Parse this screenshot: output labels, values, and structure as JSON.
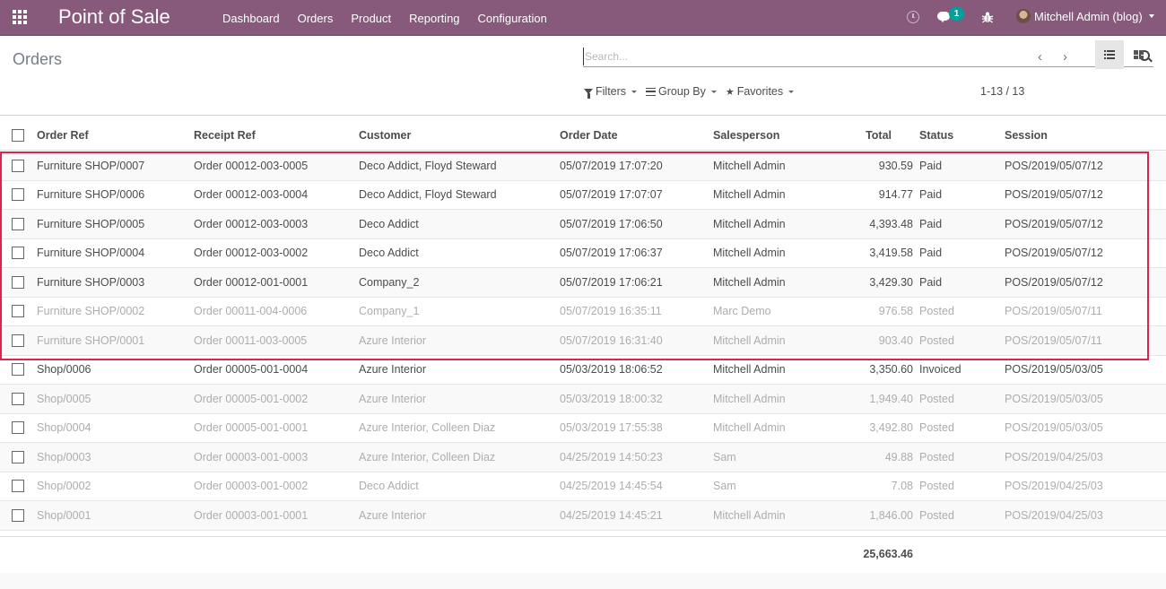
{
  "navbar": {
    "brand": "Point of Sale",
    "menu": [
      "Dashboard",
      "Orders",
      "Product",
      "Reporting",
      "Configuration"
    ],
    "chat_badge": "1",
    "user_name": "Mitchell Admin (blog)"
  },
  "control_panel": {
    "title": "Orders",
    "search_placeholder": "Search...",
    "filters_label": "Filters",
    "group_by_label": "Group By",
    "favorites_label": "Favorites",
    "pager": "1-13 / 13"
  },
  "table": {
    "headers": [
      "Order Ref",
      "Receipt Ref",
      "Customer",
      "Order Date",
      "Salesperson",
      "Total",
      "Status",
      "Session"
    ],
    "rows": [
      {
        "ref": "Furniture SHOP/0007",
        "receipt": "Order 00012-003-0005",
        "customer": "Deco Addict, Floyd Steward",
        "date": "05/07/2019 17:07:20",
        "salesperson": "Mitchell Admin",
        "total": "930.59",
        "status": "Paid",
        "session": "POS/2019/05/07/12",
        "muted": false
      },
      {
        "ref": "Furniture SHOP/0006",
        "receipt": "Order 00012-003-0004",
        "customer": "Deco Addict, Floyd Steward",
        "date": "05/07/2019 17:07:07",
        "salesperson": "Mitchell Admin",
        "total": "914.77",
        "status": "Paid",
        "session": "POS/2019/05/07/12",
        "muted": false
      },
      {
        "ref": "Furniture SHOP/0005",
        "receipt": "Order 00012-003-0003",
        "customer": "Deco Addict",
        "date": "05/07/2019 17:06:50",
        "salesperson": "Mitchell Admin",
        "total": "4,393.48",
        "status": "Paid",
        "session": "POS/2019/05/07/12",
        "muted": false
      },
      {
        "ref": "Furniture SHOP/0004",
        "receipt": "Order 00012-003-0002",
        "customer": "Deco Addict",
        "date": "05/07/2019 17:06:37",
        "salesperson": "Mitchell Admin",
        "total": "3,419.58",
        "status": "Paid",
        "session": "POS/2019/05/07/12",
        "muted": false
      },
      {
        "ref": "Furniture SHOP/0003",
        "receipt": "Order 00012-001-0001",
        "customer": "Company_2",
        "date": "05/07/2019 17:06:21",
        "salesperson": "Mitchell Admin",
        "total": "3,429.30",
        "status": "Paid",
        "session": "POS/2019/05/07/12",
        "muted": false
      },
      {
        "ref": "Furniture SHOP/0002",
        "receipt": "Order 00011-004-0006",
        "customer": "Company_1",
        "date": "05/07/2019 16:35:11",
        "salesperson": "Marc Demo",
        "total": "976.58",
        "status": "Posted",
        "session": "POS/2019/05/07/11",
        "muted": true
      },
      {
        "ref": "Furniture SHOP/0001",
        "receipt": "Order 00011-003-0005",
        "customer": "Azure Interior",
        "date": "05/07/2019 16:31:40",
        "salesperson": "Mitchell Admin",
        "total": "903.40",
        "status": "Posted",
        "session": "POS/2019/05/07/11",
        "muted": true
      },
      {
        "ref": "Shop/0006",
        "receipt": "Order 00005-001-0004",
        "customer": "Azure Interior",
        "date": "05/03/2019 18:06:52",
        "salesperson": "Mitchell Admin",
        "total": "3,350.60",
        "status": "Invoiced",
        "session": "POS/2019/05/03/05",
        "muted": false
      },
      {
        "ref": "Shop/0005",
        "receipt": "Order 00005-001-0002",
        "customer": "Azure Interior",
        "date": "05/03/2019 18:00:32",
        "salesperson": "Mitchell Admin",
        "total": "1,949.40",
        "status": "Posted",
        "session": "POS/2019/05/03/05",
        "muted": true
      },
      {
        "ref": "Shop/0004",
        "receipt": "Order 00005-001-0001",
        "customer": "Azure Interior, Colleen Diaz",
        "date": "05/03/2019 17:55:38",
        "salesperson": "Mitchell Admin",
        "total": "3,492.80",
        "status": "Posted",
        "session": "POS/2019/05/03/05",
        "muted": true
      },
      {
        "ref": "Shop/0003",
        "receipt": "Order 00003-001-0003",
        "customer": "Azure Interior, Colleen Diaz",
        "date": "04/25/2019 14:50:23",
        "salesperson": "Sam",
        "total": "49.88",
        "status": "Posted",
        "session": "POS/2019/04/25/03",
        "muted": true
      },
      {
        "ref": "Shop/0002",
        "receipt": "Order 00003-001-0002",
        "customer": "Deco Addict",
        "date": "04/25/2019 14:45:54",
        "salesperson": "Sam",
        "total": "7.08",
        "status": "Posted",
        "session": "POS/2019/04/25/03",
        "muted": true
      },
      {
        "ref": "Shop/0001",
        "receipt": "Order 00003-001-0001",
        "customer": "Azure Interior",
        "date": "04/25/2019 14:45:21",
        "salesperson": "Mitchell Admin",
        "total": "1,846.00",
        "status": "Posted",
        "session": "POS/2019/04/25/03",
        "muted": true
      }
    ],
    "footer_total": "25,663.46"
  },
  "colors": {
    "brand": "#875a7b",
    "badge": "#00a09d",
    "highlight": "#e0234d"
  }
}
